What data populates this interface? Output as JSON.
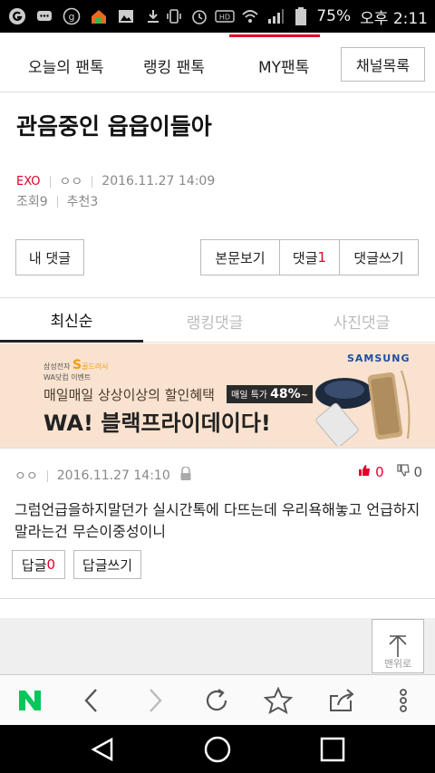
{
  "status_bar": {
    "battery": "75%",
    "time": "오후 2:11",
    "icons": [
      "g-icon",
      "chat-icon",
      "g-circle-icon",
      "home-app-icon",
      "image-icon",
      "download-icon",
      "vibrate-icon",
      "alarm-icon",
      "hd-icon",
      "wifi-icon",
      "signal-icon",
      "battery-icon"
    ]
  },
  "top_nav": {
    "tabs": [
      {
        "label": "오늘의 팬톡"
      },
      {
        "label": "랭킹 팬톡"
      },
      {
        "label": "MY팬톡"
      }
    ],
    "active_tab": "MY팬톡",
    "channel_button": "채널목록"
  },
  "article": {
    "title": "관음중인 읍읍이들아",
    "category": "EXO",
    "author": "ㅇㅇ",
    "datetime": "2016.11.27 14:09",
    "views_label": "조회9",
    "recommend_label": "추천3"
  },
  "actions": {
    "my_comments": "내 댓글",
    "view_article": "본문보기",
    "comments_label": "댓글",
    "comments_count": "1",
    "write_comment": "댓글쓰기"
  },
  "comment_tabs": [
    {
      "label": "최신순"
    },
    {
      "label": "랭킹댓글"
    },
    {
      "label": "사진댓글"
    }
  ],
  "ad": {
    "line_top": "삼성전자",
    "line_top_brand": "골드러시",
    "line_sub": "WA닷컴 이벤트",
    "line1": "매일매일 상상이상의 할인혜택",
    "badge_prefix": "매일 특가",
    "badge_value": "48%",
    "badge_suffix": "~",
    "line2": "WA! 블랙프라이데이다!",
    "brand": "SAMSUNG",
    "accent_color": "#f29b12"
  },
  "comment": {
    "author": "ㅇㅇ",
    "datetime": "2016.11.27 14:10",
    "upvotes": "0",
    "downvotes": "0",
    "text": "그럼언급을하지말던가 실시간톡에 다뜨는데 우리욕해놓고 언급하지 말라는건 무슨이중성이니",
    "reply_label": "답글",
    "reply_count": "0",
    "write_reply": "답글쓰기"
  },
  "to_top_button": "맨위로",
  "colors": {
    "accent": "#e4002b",
    "naver_green": "#03c75a"
  }
}
